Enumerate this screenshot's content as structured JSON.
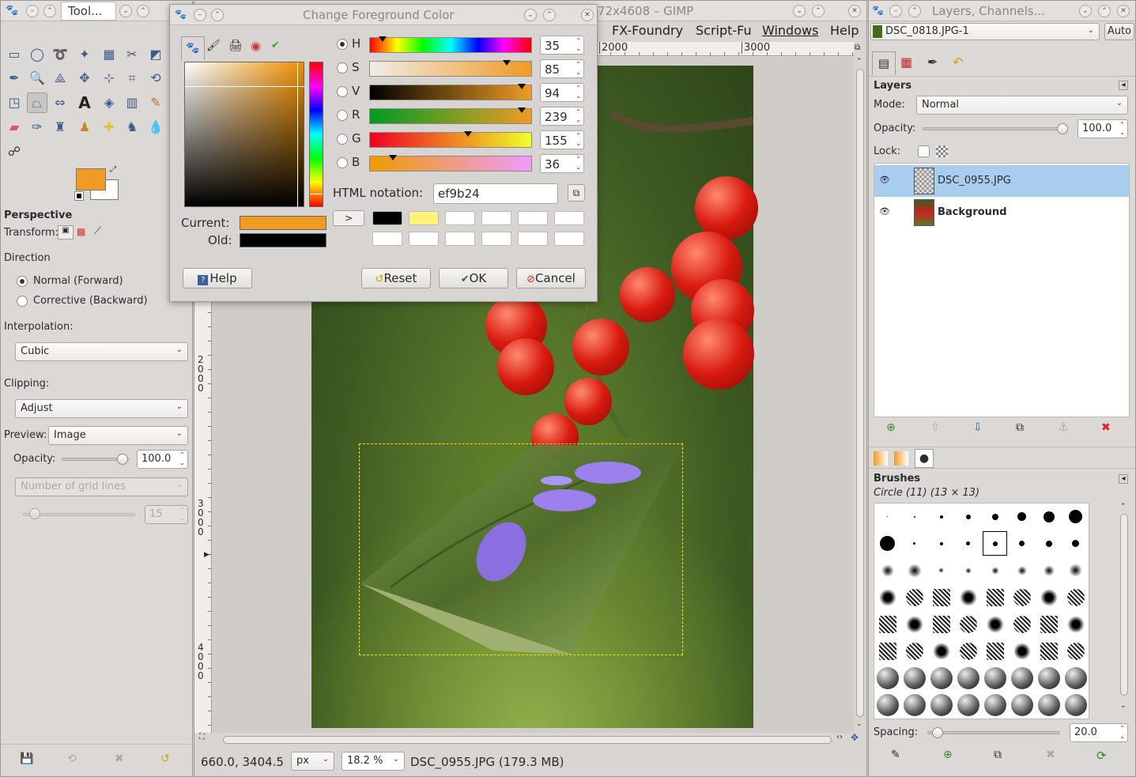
{
  "toolbox": {
    "title": "Tool...",
    "tool_options_title": "Perspective",
    "transform_label": "Transform:",
    "direction_label": "Direction",
    "direction_options": [
      "Normal (Forward)",
      "Corrective (Backward)"
    ],
    "interpolation_label": "Interpolation:",
    "interpolation_value": "Cubic",
    "clipping_label": "Clipping:",
    "clipping_value": "Adjust",
    "preview_label": "Preview:",
    "preview_value": "Image",
    "opacity_label": "Opacity:",
    "opacity_value": "100.0",
    "grid_placeholder": "Number of grid lines",
    "grid_value": "15",
    "fg_color": "#ef9b24",
    "bg_color": "#ffffff"
  },
  "main_window": {
    "title_fragment": "72x4608 – GIMP",
    "menus": [
      "FX-Foundry",
      "Script-Fu",
      "Windows",
      "Help"
    ],
    "ruler_h": [
      "2000",
      "3000"
    ],
    "ruler_v": [
      "2000",
      "3000",
      "4000"
    ],
    "status_coords": "660.0, 3404.5",
    "status_unit": "px",
    "status_zoom": "18.2 %",
    "status_file": "DSC_0955.JPG (179.3 MB)"
  },
  "color_dialog": {
    "title": "Change Foreground Color",
    "channels": [
      {
        "name": "H",
        "value": "35",
        "marker": 0.08,
        "selected": true
      },
      {
        "name": "S",
        "value": "85",
        "marker": 0.85,
        "selected": false
      },
      {
        "name": "V",
        "value": "94",
        "marker": 0.94,
        "selected": false
      },
      {
        "name": "R",
        "value": "239",
        "marker": 0.94,
        "selected": false
      },
      {
        "name": "G",
        "value": "155",
        "marker": 0.61,
        "selected": false
      },
      {
        "name": "B",
        "value": "36",
        "marker": 0.14,
        "selected": false
      }
    ],
    "html_notation_label": "HTML notation:",
    "html_notation_value": "ef9b24",
    "current_label": "Current:",
    "old_label": "Old:",
    "current_color": "#ef9b24",
    "old_color": "#000000",
    "history_row1": [
      "#000000",
      "#fff27a",
      "#ffffff",
      "#ffffff",
      "#ffffff",
      "#ffffff"
    ],
    "history_row2": [
      "#ffffff",
      "#ffffff",
      "#ffffff",
      "#ffffff",
      "#ffffff",
      "#ffffff"
    ],
    "help_label": "Help",
    "reset_label": "Reset",
    "ok_label": "OK",
    "cancel_label": "Cancel"
  },
  "layers_panel": {
    "title": "Layers, Channels...",
    "image_select": "DSC_0818.JPG-1",
    "auto_label": "Auto",
    "section_title": "Layers",
    "mode_label": "Mode:",
    "mode_value": "Normal",
    "opacity_label": "Opacity:",
    "opacity_value": "100.0",
    "lock_label": "Lock:",
    "layers": [
      {
        "name": "DSC_0955.JPG",
        "selected": true
      },
      {
        "name": "Background",
        "selected": false
      }
    ],
    "brushes_title": "Brushes",
    "brush_name": "Circle (11) (13 × 13)",
    "spacing_label": "Spacing:",
    "spacing_value": "20.0"
  }
}
